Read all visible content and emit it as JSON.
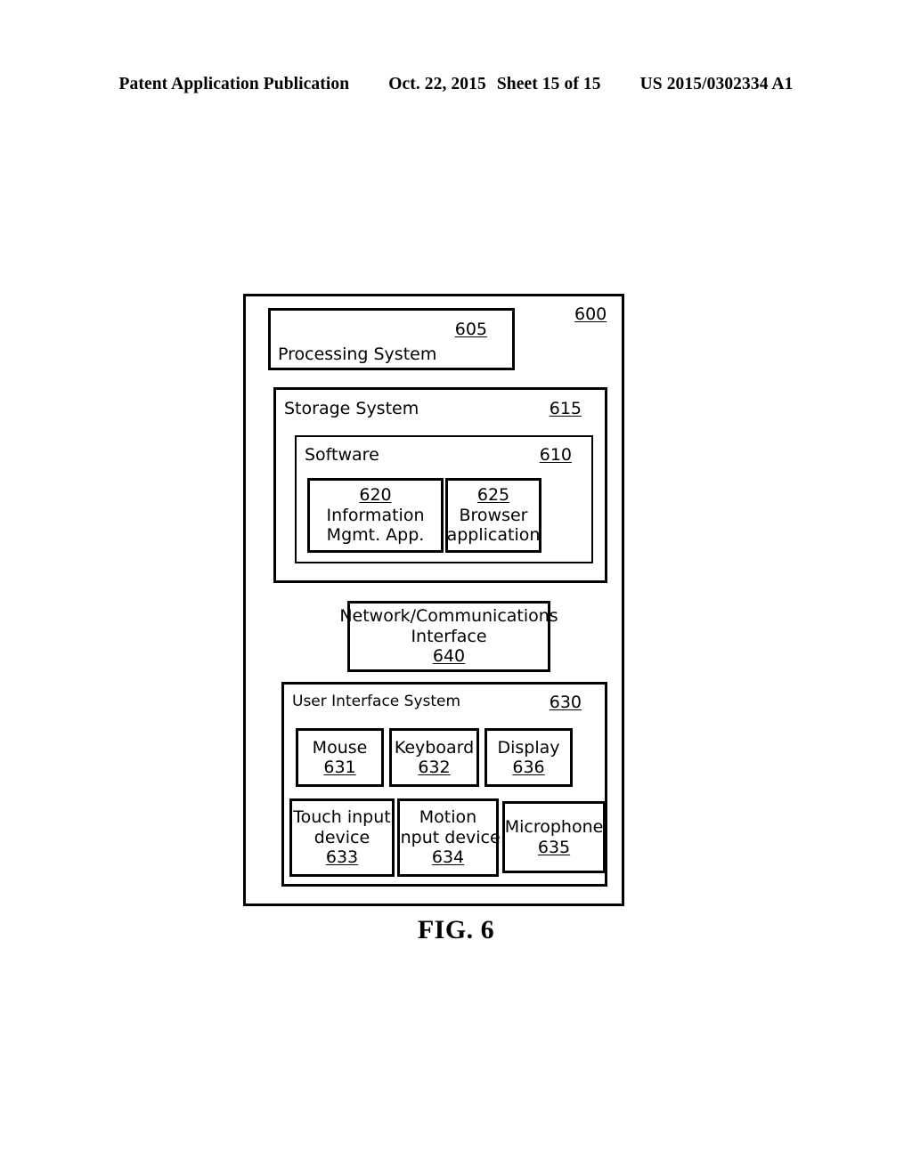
{
  "header": {
    "publication": "Patent Application Publication",
    "date": "Oct. 22, 2015",
    "sheet": "Sheet 15 of 15",
    "docnum": "US 2015/0302334 A1"
  },
  "figure": {
    "caption": "FIG. 6",
    "system_ref": "600",
    "blocks": {
      "processing_system": {
        "label": "Processing System",
        "ref": "605"
      },
      "storage_system": {
        "label": "Storage System",
        "ref": "615"
      },
      "software": {
        "label": "Software",
        "ref": "610"
      },
      "info_mgmt_app": {
        "ref": "620",
        "line1": "Information",
        "line2": "Mgmt. App."
      },
      "browser_app": {
        "ref": "625",
        "line1": "Browser",
        "line2": "application"
      },
      "network_interface": {
        "line1": "Network/Communications",
        "line2": "Interface",
        "ref": "640"
      },
      "ui_system": {
        "label": "User Interface System",
        "ref": "630"
      },
      "mouse": {
        "line1": "Mouse",
        "ref": "631"
      },
      "keyboard": {
        "line1": "Keyboard",
        "ref": "632"
      },
      "display": {
        "line1": "Display",
        "ref": "636"
      },
      "touch_input": {
        "line1": "Touch input",
        "line2": "device",
        "ref": "633"
      },
      "motion_input": {
        "line1": "Motion",
        "line2": "input device",
        "ref": "634"
      },
      "microphone": {
        "line1": "Microphone",
        "ref": "635"
      }
    }
  },
  "colors": {
    "ink": "#000000",
    "paper": "#ffffff"
  }
}
